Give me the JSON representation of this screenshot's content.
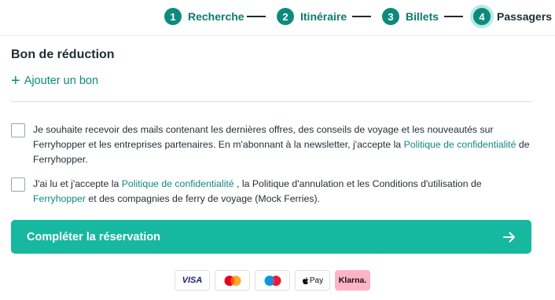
{
  "stepper": {
    "steps": [
      {
        "number": "1",
        "label": "Recherche"
      },
      {
        "number": "2",
        "label": "Itinéraire"
      },
      {
        "number": "3",
        "label": "Billets"
      },
      {
        "number": "4",
        "label": "Passagers"
      }
    ],
    "active_step": "4"
  },
  "voucher": {
    "title": "Bon de réduction",
    "add_icon": "plus-icon",
    "add_label": "Ajouter un bon"
  },
  "newsletter": {
    "text_before": "Je souhaite recevoir des mails contenant les dernières offres, des conseils de voyage et les nouveautés sur Ferryhopper et les entreprises partenaires. En m'abonnant à la newsletter, j'accepte la ",
    "privacy_link": "Politique de confidentialité",
    "text_after": " de Ferryhopper."
  },
  "terms": {
    "text_1": "J'ai lu et j'accepte la ",
    "privacy_link": "Politique de confidentialité",
    "text_2": " , la Politique d'annulation et les Conditions d'utilisation de ",
    "ferryhopper_link": "Ferryhopper",
    "text_3": " et des compagnies de ferry de voyage (Mock Ferries)."
  },
  "complete_button": {
    "label": "Compléter la réservation",
    "icon": "arrow-right-icon"
  },
  "payments": {
    "visa": "VISA",
    "mastercard": "mastercard-icon",
    "maestro": "maestro-icon",
    "applepay": "Pay",
    "klarna": "Klarna."
  },
  "colors": {
    "accent": "#0e8a7c",
    "button": "#17b8a0",
    "active_ring": "#b6ece3",
    "klarna_pink": "#ffb3c7"
  }
}
